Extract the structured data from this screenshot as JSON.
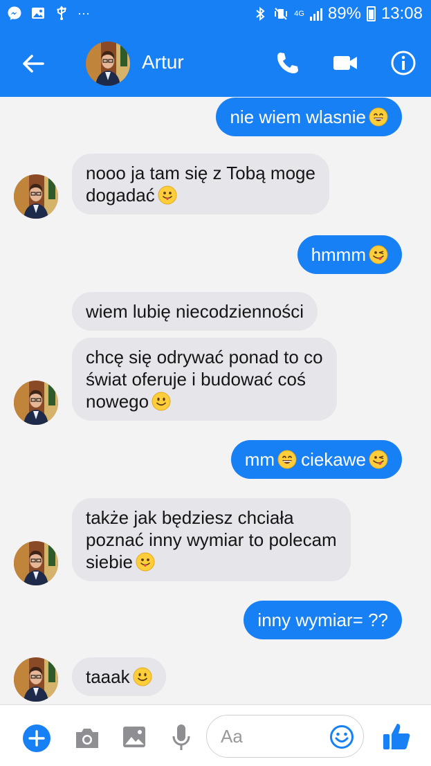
{
  "status_bar": {
    "network": "4G",
    "battery": "89%",
    "time": "13:08",
    "dots": "···"
  },
  "header": {
    "contact_name": "Artur",
    "accent_color": "#1780f5"
  },
  "messages": [
    {
      "side": "outgoing",
      "text": "nie wiem wlasnie",
      "emoji": "grin"
    },
    {
      "side": "incoming",
      "lines": [
        "nooo ja tam się z Tobą moge",
        "dogadać"
      ],
      "emoji": "tongue"
    },
    {
      "side": "outgoing",
      "text": "hmmm",
      "emoji": "wink-tongue"
    },
    {
      "side": "incoming",
      "text": "wiem lubię niecodzienności"
    },
    {
      "side": "incoming",
      "lines": [
        "chcę się odrywać ponad to co",
        "świat oferuje i budować coś",
        "nowego"
      ],
      "emoji": "smile"
    },
    {
      "side": "outgoing",
      "text_a": "mm",
      "text_b": "ciekawe",
      "emoji_a": "grin",
      "emoji_b": "wink-tongue"
    },
    {
      "side": "incoming",
      "lines": [
        "także jak będziesz chciała",
        "poznać inny wymiar to polecam",
        "siebie"
      ],
      "emoji": "tongue"
    },
    {
      "side": "outgoing",
      "text": "inny wymiar= ??"
    },
    {
      "side": "incoming",
      "text": "taaak",
      "emoji": "smile"
    }
  ],
  "composer": {
    "placeholder": "Aa",
    "value": ""
  }
}
